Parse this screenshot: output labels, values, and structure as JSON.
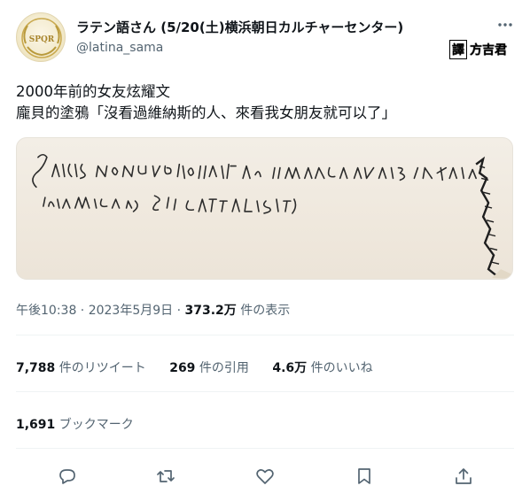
{
  "user": {
    "display_name": "ラテン語さん (5/20(土)横浜朝日カルチャーセンター)",
    "handle": "@latina_sama",
    "avatar_text": "SPQR"
  },
  "watermark": {
    "box": "譯",
    "text": "方吉君"
  },
  "tweet": {
    "line1": "2000年前的女友炫耀文",
    "line2": "龐貝的塗鴉「沒看過維納斯的人、來看我女朋友就可以了」"
  },
  "meta": {
    "time": "午後10:38 · 2023年5月9日 · ",
    "views": "373.2万",
    "views_label": " 件の表示"
  },
  "stats": {
    "retweets": "7,788",
    "retweets_label": " 件のリツイート",
    "quotes": "269",
    "quotes_label": " 件の引用",
    "likes": "4.6万",
    "likes_label": " 件のいいね"
  },
  "bookmarks": {
    "count": "1,691",
    "label": " ブックマーク"
  },
  "icons": {
    "more": "more-icon",
    "reply": "reply-icon",
    "retweet": "retweet-icon",
    "like": "like-icon",
    "bookmark": "bookmark-icon",
    "share": "share-icon"
  },
  "colors": {
    "text": "#0f1419",
    "secondary": "#536471",
    "divider": "#eff3f4"
  }
}
